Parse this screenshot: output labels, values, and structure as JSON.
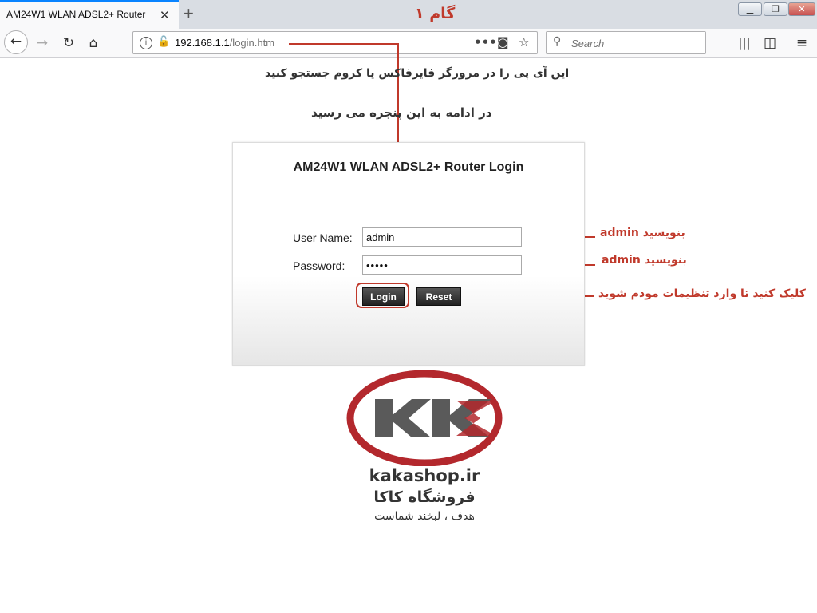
{
  "browser": {
    "tab_title": "AM24W1 WLAN ADSL2+ Router",
    "tab_close": "✕",
    "new_tab": "+",
    "url_host": "192.168.1.1",
    "url_path": "/login.htm",
    "search_placeholder": "Search",
    "icons": [
      "back-icon",
      "forward-icon",
      "reload-icon",
      "home-icon",
      "info-icon",
      "insecure-lock-icon",
      "page-actions-icon",
      "pocket-icon",
      "bookmark-star-icon",
      "search-icon",
      "library-icon",
      "sidebar-icon",
      "menu-icon"
    ]
  },
  "annotations": {
    "step": "گام ۱",
    "ip_instruction": "این آی پی را در مرورگر فایرفاکس یا کروم جستجو کنید",
    "window_instruction": "در ادامه به این پنجره می رسید",
    "username_hint_prefix": "بنویسید",
    "username_hint_value": "admin",
    "password_hint_prefix": "بنویسید",
    "password_hint_value": "admin",
    "login_hint": "کلیک کنید تا وارد تنظیمات مودم شوید",
    "color": "#c0392b"
  },
  "login": {
    "title": "AM24W1 WLAN ADSL2+ Router Login",
    "username_label": "User Name:",
    "username_value": "admin",
    "password_label": "Password:",
    "password_value": "•••••",
    "login_button": "Login",
    "reset_button": "Reset"
  },
  "logo": {
    "brand": "kakashop.ir",
    "name_fa": "فروشگاه کاکا",
    "slogan_fa": "هدف ، لبخند شماست",
    "colors": {
      "ring": "#b3282d",
      "letters": "#5a5a5a"
    }
  }
}
